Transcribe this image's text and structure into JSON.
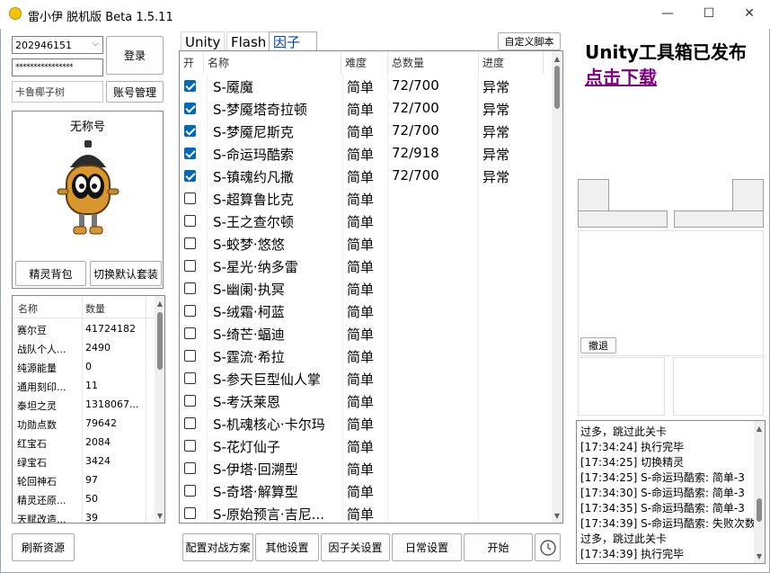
{
  "window": {
    "title": "雷小伊 脱机版 Beta 1.5.11",
    "minimize": "—",
    "maximize": "☐",
    "close": "✕"
  },
  "account": {
    "id_value": "202946151",
    "password_value": "****************",
    "nickname_value": "卡鲁椰子树",
    "login_button": "登录",
    "account_manage_button": "账号管理"
  },
  "avatar": {
    "name": "无称号",
    "spirit_bag_button": "精灵背包",
    "switch_suit_button": "切换默认套装"
  },
  "resources": {
    "headers": [
      "名称",
      "数量"
    ],
    "rows": [
      {
        "name": "赛尔豆",
        "count": "41724182"
      },
      {
        "name": "战队个人...",
        "count": "2490"
      },
      {
        "name": "纯源能量",
        "count": "0"
      },
      {
        "name": "通用刻印...",
        "count": "11"
      },
      {
        "name": "泰坦之灵",
        "count": "1318067..."
      },
      {
        "name": "功勋点数",
        "count": "79642"
      },
      {
        "name": "红宝石",
        "count": "2084"
      },
      {
        "name": "绿宝石",
        "count": "3424"
      },
      {
        "name": "轮回神石",
        "count": "97"
      },
      {
        "name": "精灵还原...",
        "count": "50"
      },
      {
        "name": "天赋改造...",
        "count": "39"
      }
    ],
    "refresh_button": "刷新资源"
  },
  "tabs": {
    "items": [
      "Unity",
      "Flash",
      "因子"
    ],
    "custom_script_button": "自定义脚本"
  },
  "levels": {
    "headers": [
      "开",
      "名称",
      "难度",
      "总数量",
      "进度"
    ],
    "rows": [
      {
        "checked": true,
        "name": "S-魇魔",
        "difficulty": "简单",
        "total": "72/700",
        "progress": "异常"
      },
      {
        "checked": true,
        "name": "S-梦魇塔奇拉顿",
        "difficulty": "简单",
        "total": "72/700",
        "progress": "异常"
      },
      {
        "checked": true,
        "name": "S-梦魇尼斯克",
        "difficulty": "简单",
        "total": "72/700",
        "progress": "异常"
      },
      {
        "checked": true,
        "name": "S-命运玛酷索",
        "difficulty": "简单",
        "total": "72/918",
        "progress": "异常"
      },
      {
        "checked": true,
        "name": "S-镇魂约凡撒",
        "difficulty": "简单",
        "total": "72/700",
        "progress": "异常"
      },
      {
        "checked": false,
        "name": "S-超算鲁比克",
        "difficulty": "简单",
        "total": "",
        "progress": ""
      },
      {
        "checked": false,
        "name": "S-王之查尔顿",
        "difficulty": "简单",
        "total": "",
        "progress": ""
      },
      {
        "checked": false,
        "name": "S-蛟梦·悠悠",
        "difficulty": "简单",
        "total": "",
        "progress": ""
      },
      {
        "checked": false,
        "name": "S-星光·纳多雷",
        "difficulty": "简单",
        "total": "",
        "progress": ""
      },
      {
        "checked": false,
        "name": "S-幽阑·执冥",
        "difficulty": "简单",
        "total": "",
        "progress": ""
      },
      {
        "checked": false,
        "name": "S-绒霜·柯蓝",
        "difficulty": "简单",
        "total": "",
        "progress": ""
      },
      {
        "checked": false,
        "name": "S-绮芒·蝠迪",
        "difficulty": "简单",
        "total": "",
        "progress": ""
      },
      {
        "checked": false,
        "name": "S-霆流·希拉",
        "difficulty": "简单",
        "total": "",
        "progress": ""
      },
      {
        "checked": false,
        "name": "S-参天巨型仙人掌",
        "difficulty": "简单",
        "total": "",
        "progress": ""
      },
      {
        "checked": false,
        "name": "S-考沃莱恩",
        "difficulty": "简单",
        "total": "",
        "progress": ""
      },
      {
        "checked": false,
        "name": "S-机魂核心·卡尔玛",
        "difficulty": "简单",
        "total": "",
        "progress": ""
      },
      {
        "checked": false,
        "name": "S-花灯仙子",
        "difficulty": "简单",
        "total": "",
        "progress": ""
      },
      {
        "checked": false,
        "name": "S-伊塔·回溯型",
        "difficulty": "简单",
        "total": "",
        "progress": ""
      },
      {
        "checked": false,
        "name": "S-奇塔·解算型",
        "difficulty": "简单",
        "total": "",
        "progress": ""
      },
      {
        "checked": false,
        "name": "S-原始预言·吉尼...",
        "difficulty": "简单",
        "total": "",
        "progress": ""
      }
    ]
  },
  "bottom_buttons": {
    "battle_plan": "配置对战方案",
    "other_settings": "其他设置",
    "factor_settings": "因子关设置",
    "daily_settings": "日常设置",
    "start": "开始"
  },
  "promo": {
    "title": "Unity工具箱已发布",
    "link": "点击下载"
  },
  "undo_button": "撤退",
  "log": [
    "过多，跳过此关卡",
    "[17:34:24]  执行完毕",
    "[17:34:25] 切换精灵",
    "[17:34:25] S-命运玛酷索: 简单-3",
    "[17:34:30] S-命运玛酷索: 简单-3",
    "[17:34:35] S-命运玛酷索: 简单-3",
    "[17:34:39] S-命运玛酷索: 失败次数",
    "过多，跳过此关卡",
    "[17:34:39]  执行完毕"
  ]
}
